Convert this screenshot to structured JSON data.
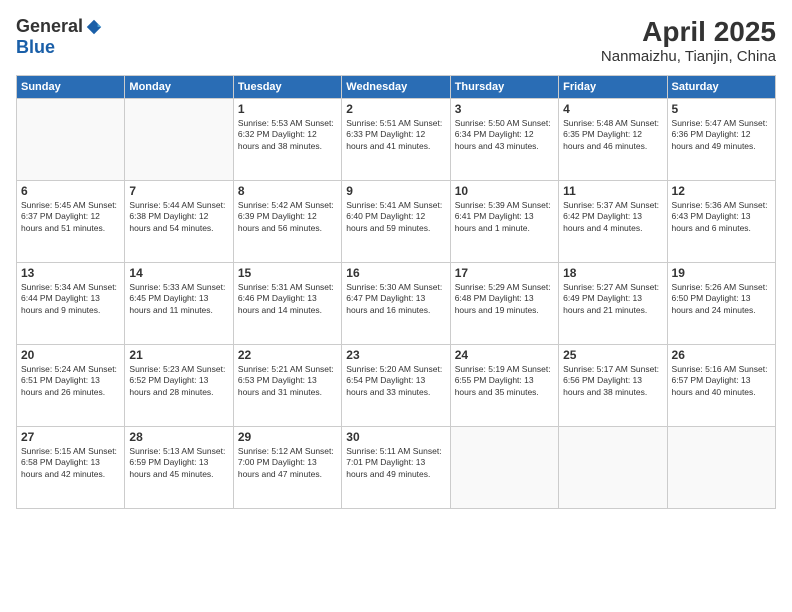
{
  "header": {
    "logo_general": "General",
    "logo_blue": "Blue",
    "title": "April 2025",
    "location": "Nanmaizhu, Tianjin, China"
  },
  "days_of_week": [
    "Sunday",
    "Monday",
    "Tuesday",
    "Wednesday",
    "Thursday",
    "Friday",
    "Saturday"
  ],
  "weeks": [
    [
      {
        "day": "",
        "info": ""
      },
      {
        "day": "",
        "info": ""
      },
      {
        "day": "1",
        "info": "Sunrise: 5:53 AM\nSunset: 6:32 PM\nDaylight: 12 hours\nand 38 minutes."
      },
      {
        "day": "2",
        "info": "Sunrise: 5:51 AM\nSunset: 6:33 PM\nDaylight: 12 hours\nand 41 minutes."
      },
      {
        "day": "3",
        "info": "Sunrise: 5:50 AM\nSunset: 6:34 PM\nDaylight: 12 hours\nand 43 minutes."
      },
      {
        "day": "4",
        "info": "Sunrise: 5:48 AM\nSunset: 6:35 PM\nDaylight: 12 hours\nand 46 minutes."
      },
      {
        "day": "5",
        "info": "Sunrise: 5:47 AM\nSunset: 6:36 PM\nDaylight: 12 hours\nand 49 minutes."
      }
    ],
    [
      {
        "day": "6",
        "info": "Sunrise: 5:45 AM\nSunset: 6:37 PM\nDaylight: 12 hours\nand 51 minutes."
      },
      {
        "day": "7",
        "info": "Sunrise: 5:44 AM\nSunset: 6:38 PM\nDaylight: 12 hours\nand 54 minutes."
      },
      {
        "day": "8",
        "info": "Sunrise: 5:42 AM\nSunset: 6:39 PM\nDaylight: 12 hours\nand 56 minutes."
      },
      {
        "day": "9",
        "info": "Sunrise: 5:41 AM\nSunset: 6:40 PM\nDaylight: 12 hours\nand 59 minutes."
      },
      {
        "day": "10",
        "info": "Sunrise: 5:39 AM\nSunset: 6:41 PM\nDaylight: 13 hours\nand 1 minute."
      },
      {
        "day": "11",
        "info": "Sunrise: 5:37 AM\nSunset: 6:42 PM\nDaylight: 13 hours\nand 4 minutes."
      },
      {
        "day": "12",
        "info": "Sunrise: 5:36 AM\nSunset: 6:43 PM\nDaylight: 13 hours\nand 6 minutes."
      }
    ],
    [
      {
        "day": "13",
        "info": "Sunrise: 5:34 AM\nSunset: 6:44 PM\nDaylight: 13 hours\nand 9 minutes."
      },
      {
        "day": "14",
        "info": "Sunrise: 5:33 AM\nSunset: 6:45 PM\nDaylight: 13 hours\nand 11 minutes."
      },
      {
        "day": "15",
        "info": "Sunrise: 5:31 AM\nSunset: 6:46 PM\nDaylight: 13 hours\nand 14 minutes."
      },
      {
        "day": "16",
        "info": "Sunrise: 5:30 AM\nSunset: 6:47 PM\nDaylight: 13 hours\nand 16 minutes."
      },
      {
        "day": "17",
        "info": "Sunrise: 5:29 AM\nSunset: 6:48 PM\nDaylight: 13 hours\nand 19 minutes."
      },
      {
        "day": "18",
        "info": "Sunrise: 5:27 AM\nSunset: 6:49 PM\nDaylight: 13 hours\nand 21 minutes."
      },
      {
        "day": "19",
        "info": "Sunrise: 5:26 AM\nSunset: 6:50 PM\nDaylight: 13 hours\nand 24 minutes."
      }
    ],
    [
      {
        "day": "20",
        "info": "Sunrise: 5:24 AM\nSunset: 6:51 PM\nDaylight: 13 hours\nand 26 minutes."
      },
      {
        "day": "21",
        "info": "Sunrise: 5:23 AM\nSunset: 6:52 PM\nDaylight: 13 hours\nand 28 minutes."
      },
      {
        "day": "22",
        "info": "Sunrise: 5:21 AM\nSunset: 6:53 PM\nDaylight: 13 hours\nand 31 minutes."
      },
      {
        "day": "23",
        "info": "Sunrise: 5:20 AM\nSunset: 6:54 PM\nDaylight: 13 hours\nand 33 minutes."
      },
      {
        "day": "24",
        "info": "Sunrise: 5:19 AM\nSunset: 6:55 PM\nDaylight: 13 hours\nand 35 minutes."
      },
      {
        "day": "25",
        "info": "Sunrise: 5:17 AM\nSunset: 6:56 PM\nDaylight: 13 hours\nand 38 minutes."
      },
      {
        "day": "26",
        "info": "Sunrise: 5:16 AM\nSunset: 6:57 PM\nDaylight: 13 hours\nand 40 minutes."
      }
    ],
    [
      {
        "day": "27",
        "info": "Sunrise: 5:15 AM\nSunset: 6:58 PM\nDaylight: 13 hours\nand 42 minutes."
      },
      {
        "day": "28",
        "info": "Sunrise: 5:13 AM\nSunset: 6:59 PM\nDaylight: 13 hours\nand 45 minutes."
      },
      {
        "day": "29",
        "info": "Sunrise: 5:12 AM\nSunset: 7:00 PM\nDaylight: 13 hours\nand 47 minutes."
      },
      {
        "day": "30",
        "info": "Sunrise: 5:11 AM\nSunset: 7:01 PM\nDaylight: 13 hours\nand 49 minutes."
      },
      {
        "day": "",
        "info": ""
      },
      {
        "day": "",
        "info": ""
      },
      {
        "day": "",
        "info": ""
      }
    ]
  ]
}
